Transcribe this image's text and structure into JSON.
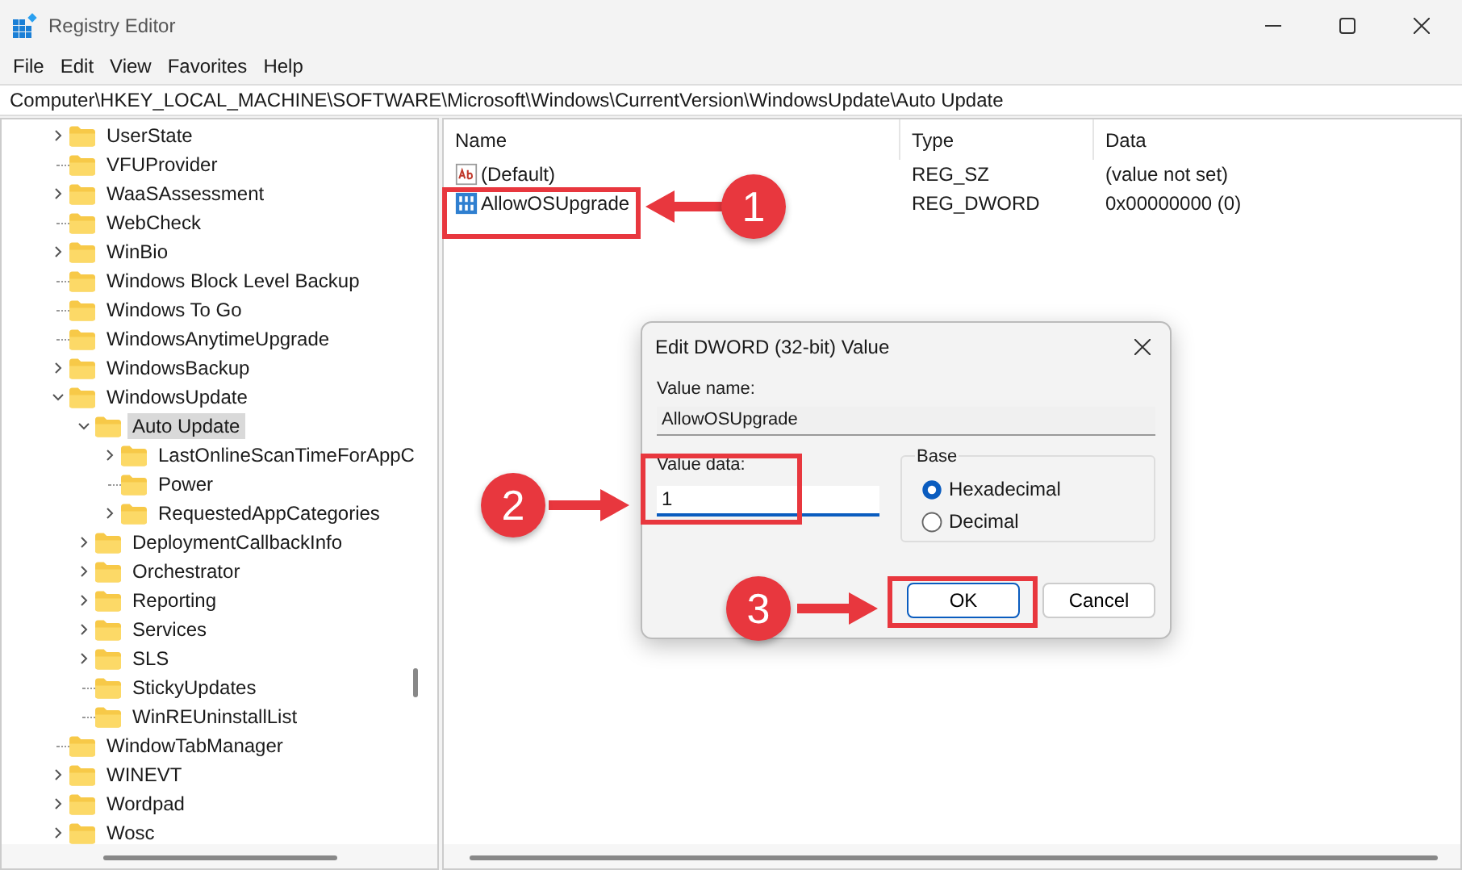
{
  "window": {
    "title": "Registry Editor"
  },
  "menu": [
    "File",
    "Edit",
    "View",
    "Favorites",
    "Help"
  ],
  "address": "Computer\\HKEY_LOCAL_MACHINE\\SOFTWARE\\Microsoft\\Windows\\CurrentVersion\\WindowsUpdate\\Auto Update",
  "tree": [
    {
      "label": "UserState",
      "expandable": true,
      "expanded": false,
      "selected": false
    },
    {
      "label": "VFUProvider",
      "expandable": false,
      "selected": false
    },
    {
      "label": "WaaSAssessment",
      "expandable": true,
      "expanded": false,
      "selected": false
    },
    {
      "label": "WebCheck",
      "expandable": false,
      "selected": false
    },
    {
      "label": "WinBio",
      "expandable": true,
      "expanded": false,
      "selected": false
    },
    {
      "label": "Windows Block Level Backup",
      "expandable": false,
      "selected": false
    },
    {
      "label": "Windows To Go",
      "expandable": false,
      "selected": false
    },
    {
      "label": "WindowsAnytimeUpgrade",
      "expandable": false,
      "selected": false
    },
    {
      "label": "WindowsBackup",
      "expandable": true,
      "expanded": false,
      "selected": false
    },
    {
      "label": "WindowsUpdate",
      "expandable": true,
      "expanded": true,
      "selected": false,
      "children": [
        {
          "label": "Auto Update",
          "expandable": true,
          "expanded": true,
          "selected": true,
          "children": [
            {
              "label": "LastOnlineScanTimeForAppC",
              "expandable": true,
              "expanded": false,
              "selected": false
            },
            {
              "label": "Power",
              "expandable": false,
              "selected": false
            },
            {
              "label": "RequestedAppCategories",
              "expandable": true,
              "expanded": false,
              "selected": false
            }
          ]
        },
        {
          "label": "DeploymentCallbackInfo",
          "expandable": true,
          "expanded": false,
          "selected": false
        },
        {
          "label": "Orchestrator",
          "expandable": true,
          "expanded": false,
          "selected": false
        },
        {
          "label": "Reporting",
          "expandable": true,
          "expanded": false,
          "selected": false
        },
        {
          "label": "Services",
          "expandable": true,
          "expanded": false,
          "selected": false
        },
        {
          "label": "SLS",
          "expandable": true,
          "expanded": false,
          "selected": false
        },
        {
          "label": "StickyUpdates",
          "expandable": false,
          "selected": false
        },
        {
          "label": "WinREUninstallList",
          "expandable": false,
          "selected": false
        }
      ]
    },
    {
      "label": "WindowTabManager",
      "expandable": false,
      "selected": false
    },
    {
      "label": "WINEVT",
      "expandable": true,
      "expanded": false,
      "selected": false
    },
    {
      "label": "Wordpad",
      "expandable": true,
      "expanded": false,
      "selected": false
    },
    {
      "label": "Wosc",
      "expandable": true,
      "expanded": false,
      "selected": false
    }
  ],
  "table": {
    "columns": [
      "Name",
      "Type",
      "Data"
    ],
    "rows": [
      {
        "kind": "string",
        "name": "(Default)",
        "type": "REG_SZ",
        "data": "(value not set)"
      },
      {
        "kind": "binary",
        "name": "AllowOSUpgrade",
        "type": "REG_DWORD",
        "data": "0x00000000 (0)"
      }
    ]
  },
  "dialog": {
    "title": "Edit DWORD (32-bit) Value",
    "value_name_label": "Value name:",
    "value_name": "AllowOSUpgrade",
    "value_data_label": "Value data:",
    "value_data": "1",
    "base_label": "Base",
    "base_options": [
      {
        "label": "Hexadecimal",
        "selected": true
      },
      {
        "label": "Decimal",
        "selected": false
      }
    ],
    "buttons": [
      {
        "label": "OK",
        "default": true
      },
      {
        "label": "Cancel",
        "default": false
      }
    ]
  },
  "annotations": [
    {
      "number": "1"
    },
    {
      "number": "2"
    },
    {
      "number": "3"
    }
  ]
}
